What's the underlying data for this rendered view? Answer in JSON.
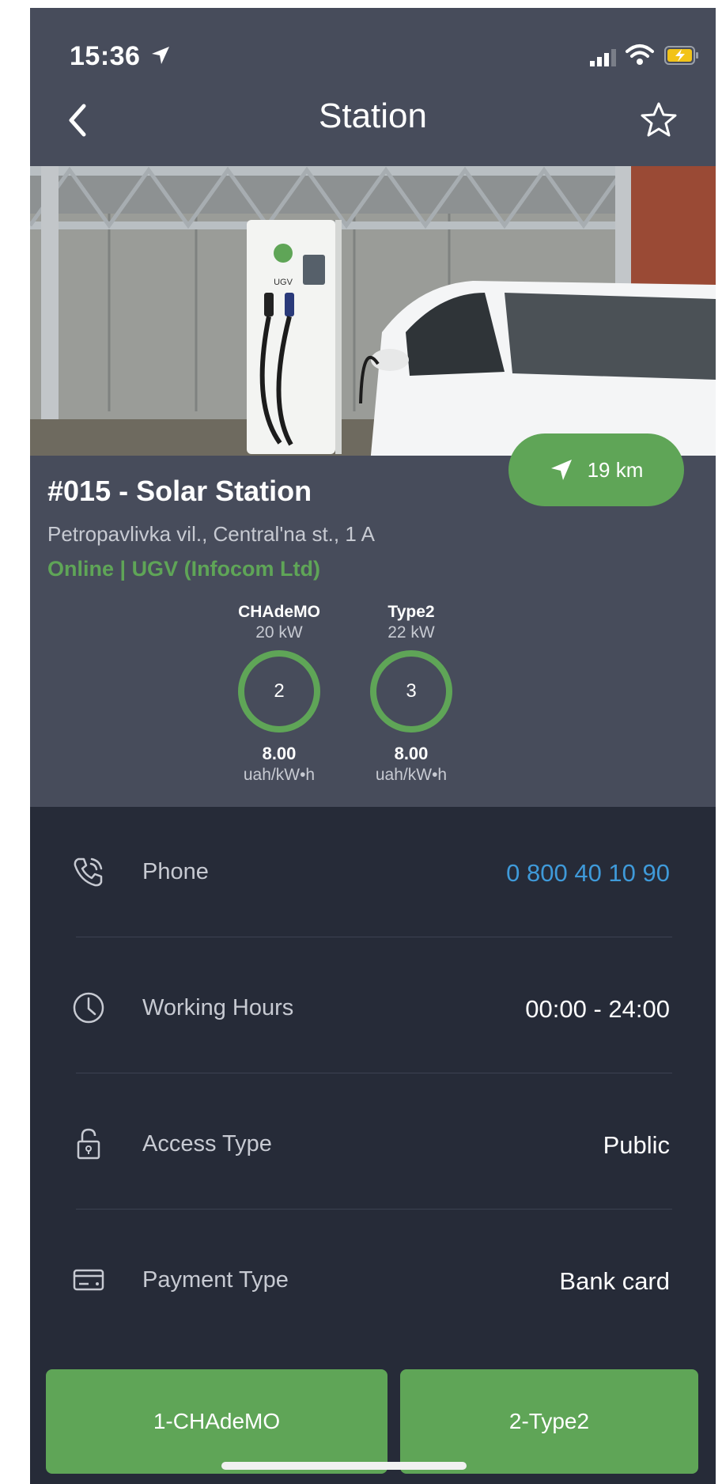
{
  "status_bar": {
    "time": "15:36"
  },
  "header": {
    "title": "Station"
  },
  "station": {
    "name": "#015 - Solar Station",
    "address": "Petropavlivka vil., Central'na st., 1 A",
    "status": "Online | UGV (Infocom Ltd)",
    "distance": "19 km",
    "charger_brand": "UGV"
  },
  "connectors": [
    {
      "type": "CHAdeMO",
      "power": "20 kW",
      "count": "2",
      "price": "8.00",
      "unit": "uah/kW•h"
    },
    {
      "type": "Type2",
      "power": "22 kW",
      "count": "3",
      "price": "8.00",
      "unit": "uah/kW•h"
    }
  ],
  "details": [
    {
      "label": "Phone",
      "value": "0 800 40 10 90",
      "icon": "phone-icon"
    },
    {
      "label": "Working Hours",
      "value": "00:00 - 24:00",
      "icon": "clock-icon"
    },
    {
      "label": "Access Type",
      "value": "Public",
      "icon": "lock-icon"
    },
    {
      "label": "Payment Type",
      "value": "Bank card",
      "icon": "card-icon"
    }
  ],
  "buttons": {
    "connector_1": "1-CHAdeMO",
    "connector_2": "2-Type2"
  },
  "colors": {
    "accent_green": "#5fa557",
    "link_blue": "#3f9ad9",
    "header_bg": "#474c5b",
    "body_bg": "#262b38"
  }
}
